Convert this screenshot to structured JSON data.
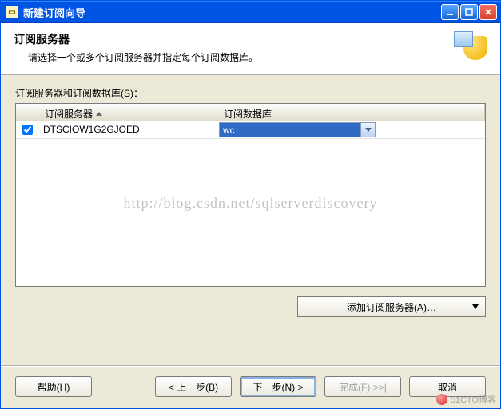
{
  "window": {
    "title": "新建订阅向导"
  },
  "header": {
    "title": "订阅服务器",
    "subtitle": "请选择一个或多个订阅服务器并指定每个订阅数据库。"
  },
  "list": {
    "label": "订阅服务器和订阅数据库(S)：",
    "columns": {
      "server": "订阅服务器",
      "database": "订阅数据库"
    },
    "rows": [
      {
        "checked": true,
        "server": "DTSCIOW1G2GJOED",
        "database": "wc"
      }
    ]
  },
  "buttons": {
    "add_server": "添加订阅服务器(A)…",
    "help": "帮助(H)",
    "back": "< 上一步(B)",
    "next": "下一步(N) >",
    "finish": "完成(F) >>|",
    "cancel": "取消"
  },
  "watermark": "http://blog.csdn.net/sqlserverdiscovery",
  "brand": "51CTO博客"
}
